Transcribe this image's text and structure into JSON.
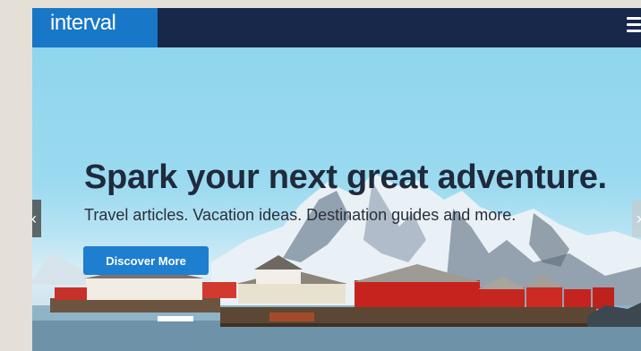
{
  "header": {
    "logo_text": "interval",
    "menu_icon": "hamburger-icon",
    "colors": {
      "bar": "#17284a",
      "logo_bg": "#1877c7"
    }
  },
  "hero": {
    "headline": "Spark your next great adventure.",
    "subtitle": "Travel articles. Vacation ideas. Destination guides and more.",
    "cta_label": "Discover More",
    "prev_label": "‹",
    "next_label": "›",
    "colors": {
      "cta": "#1e7ed0",
      "sky": "#9bdaf0"
    }
  }
}
